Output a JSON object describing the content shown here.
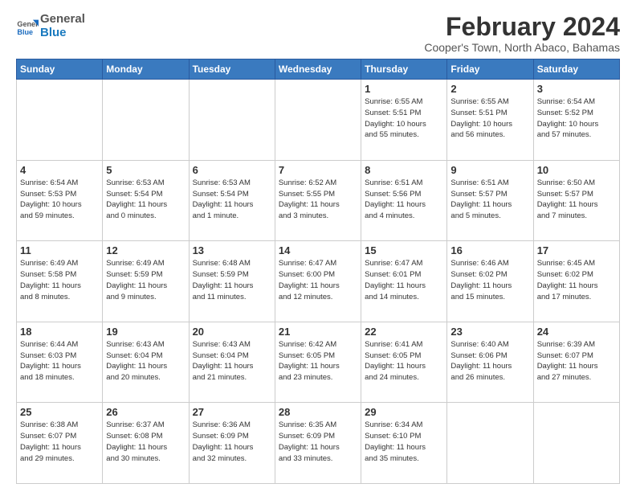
{
  "header": {
    "logo_general": "General",
    "logo_blue": "Blue",
    "month_title": "February 2024",
    "subtitle": "Cooper's Town, North Abaco, Bahamas"
  },
  "days_of_week": [
    "Sunday",
    "Monday",
    "Tuesday",
    "Wednesday",
    "Thursday",
    "Friday",
    "Saturday"
  ],
  "weeks": [
    [
      {
        "day": "",
        "detail": ""
      },
      {
        "day": "",
        "detail": ""
      },
      {
        "day": "",
        "detail": ""
      },
      {
        "day": "",
        "detail": ""
      },
      {
        "day": "1",
        "detail": "Sunrise: 6:55 AM\nSunset: 5:51 PM\nDaylight: 10 hours\nand 55 minutes."
      },
      {
        "day": "2",
        "detail": "Sunrise: 6:55 AM\nSunset: 5:51 PM\nDaylight: 10 hours\nand 56 minutes."
      },
      {
        "day": "3",
        "detail": "Sunrise: 6:54 AM\nSunset: 5:52 PM\nDaylight: 10 hours\nand 57 minutes."
      }
    ],
    [
      {
        "day": "4",
        "detail": "Sunrise: 6:54 AM\nSunset: 5:53 PM\nDaylight: 10 hours\nand 59 minutes."
      },
      {
        "day": "5",
        "detail": "Sunrise: 6:53 AM\nSunset: 5:54 PM\nDaylight: 11 hours\nand 0 minutes."
      },
      {
        "day": "6",
        "detail": "Sunrise: 6:53 AM\nSunset: 5:54 PM\nDaylight: 11 hours\nand 1 minute."
      },
      {
        "day": "7",
        "detail": "Sunrise: 6:52 AM\nSunset: 5:55 PM\nDaylight: 11 hours\nand 3 minutes."
      },
      {
        "day": "8",
        "detail": "Sunrise: 6:51 AM\nSunset: 5:56 PM\nDaylight: 11 hours\nand 4 minutes."
      },
      {
        "day": "9",
        "detail": "Sunrise: 6:51 AM\nSunset: 5:57 PM\nDaylight: 11 hours\nand 5 minutes."
      },
      {
        "day": "10",
        "detail": "Sunrise: 6:50 AM\nSunset: 5:57 PM\nDaylight: 11 hours\nand 7 minutes."
      }
    ],
    [
      {
        "day": "11",
        "detail": "Sunrise: 6:49 AM\nSunset: 5:58 PM\nDaylight: 11 hours\nand 8 minutes."
      },
      {
        "day": "12",
        "detail": "Sunrise: 6:49 AM\nSunset: 5:59 PM\nDaylight: 11 hours\nand 9 minutes."
      },
      {
        "day": "13",
        "detail": "Sunrise: 6:48 AM\nSunset: 5:59 PM\nDaylight: 11 hours\nand 11 minutes."
      },
      {
        "day": "14",
        "detail": "Sunrise: 6:47 AM\nSunset: 6:00 PM\nDaylight: 11 hours\nand 12 minutes."
      },
      {
        "day": "15",
        "detail": "Sunrise: 6:47 AM\nSunset: 6:01 PM\nDaylight: 11 hours\nand 14 minutes."
      },
      {
        "day": "16",
        "detail": "Sunrise: 6:46 AM\nSunset: 6:02 PM\nDaylight: 11 hours\nand 15 minutes."
      },
      {
        "day": "17",
        "detail": "Sunrise: 6:45 AM\nSunset: 6:02 PM\nDaylight: 11 hours\nand 17 minutes."
      }
    ],
    [
      {
        "day": "18",
        "detail": "Sunrise: 6:44 AM\nSunset: 6:03 PM\nDaylight: 11 hours\nand 18 minutes."
      },
      {
        "day": "19",
        "detail": "Sunrise: 6:43 AM\nSunset: 6:04 PM\nDaylight: 11 hours\nand 20 minutes."
      },
      {
        "day": "20",
        "detail": "Sunrise: 6:43 AM\nSunset: 6:04 PM\nDaylight: 11 hours\nand 21 minutes."
      },
      {
        "day": "21",
        "detail": "Sunrise: 6:42 AM\nSunset: 6:05 PM\nDaylight: 11 hours\nand 23 minutes."
      },
      {
        "day": "22",
        "detail": "Sunrise: 6:41 AM\nSunset: 6:05 PM\nDaylight: 11 hours\nand 24 minutes."
      },
      {
        "day": "23",
        "detail": "Sunrise: 6:40 AM\nSunset: 6:06 PM\nDaylight: 11 hours\nand 26 minutes."
      },
      {
        "day": "24",
        "detail": "Sunrise: 6:39 AM\nSunset: 6:07 PM\nDaylight: 11 hours\nand 27 minutes."
      }
    ],
    [
      {
        "day": "25",
        "detail": "Sunrise: 6:38 AM\nSunset: 6:07 PM\nDaylight: 11 hours\nand 29 minutes."
      },
      {
        "day": "26",
        "detail": "Sunrise: 6:37 AM\nSunset: 6:08 PM\nDaylight: 11 hours\nand 30 minutes."
      },
      {
        "day": "27",
        "detail": "Sunrise: 6:36 AM\nSunset: 6:09 PM\nDaylight: 11 hours\nand 32 minutes."
      },
      {
        "day": "28",
        "detail": "Sunrise: 6:35 AM\nSunset: 6:09 PM\nDaylight: 11 hours\nand 33 minutes."
      },
      {
        "day": "29",
        "detail": "Sunrise: 6:34 AM\nSunset: 6:10 PM\nDaylight: 11 hours\nand 35 minutes."
      },
      {
        "day": "",
        "detail": ""
      },
      {
        "day": "",
        "detail": ""
      }
    ]
  ]
}
